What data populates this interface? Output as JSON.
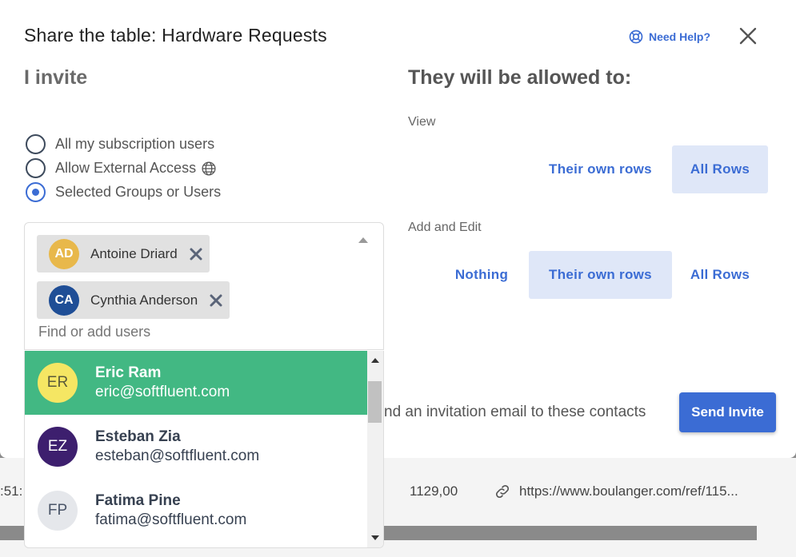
{
  "dialog": {
    "title": "Share the table: Hardware Requests",
    "help_label": "Need Help?"
  },
  "invite": {
    "title": "I invite",
    "options": [
      {
        "label": "All my subscription users",
        "selected": false
      },
      {
        "label": "Allow External Access",
        "selected": false
      },
      {
        "label": "Selected Groups or Users",
        "selected": true
      }
    ],
    "chips": [
      {
        "initials": "AD",
        "name": "Antoine Driard",
        "color": "#e8b84b"
      },
      {
        "initials": "CA",
        "name": "Cynthia Anderson",
        "color": "#1f4e96"
      }
    ],
    "input_placeholder": "Find or add users",
    "suggestions": [
      {
        "initials": "ER",
        "name": "Eric Ram",
        "email": "eric@softfluent.com",
        "color": "#f5e663",
        "text_color": "#5a5a3a",
        "active": true
      },
      {
        "initials": "EZ",
        "name": "Esteban Zia",
        "email": "esteban@softfluent.com",
        "color": "#3d1f6e",
        "text_color": "#ffffff",
        "active": false
      },
      {
        "initials": "FP",
        "name": "Fatima Pine",
        "email": "fatima@softfluent.com",
        "color": "#e5e7eb",
        "text_color": "#4a5568",
        "active": false
      }
    ]
  },
  "permissions": {
    "title": "They will be allowed to:",
    "view": {
      "label": "View",
      "options": [
        {
          "label": "Their own rows",
          "selected": false
        },
        {
          "label": "All Rows",
          "selected": true
        }
      ]
    },
    "edit": {
      "label": "Add and Edit",
      "options": [
        {
          "label": "Nothing",
          "selected": false
        },
        {
          "label": "Their own rows",
          "selected": true
        },
        {
          "label": "All Rows",
          "selected": false
        }
      ]
    }
  },
  "footer": {
    "send_text": "nd an invitation email to these contacts",
    "send_button": "Send Invite"
  },
  "background_row": {
    "time_fragment": ":51:",
    "amount": "1129,00",
    "url": "https://www.boulanger.com/ref/115..."
  },
  "accent": "#3b6cd4",
  "active_green": "#42b883"
}
